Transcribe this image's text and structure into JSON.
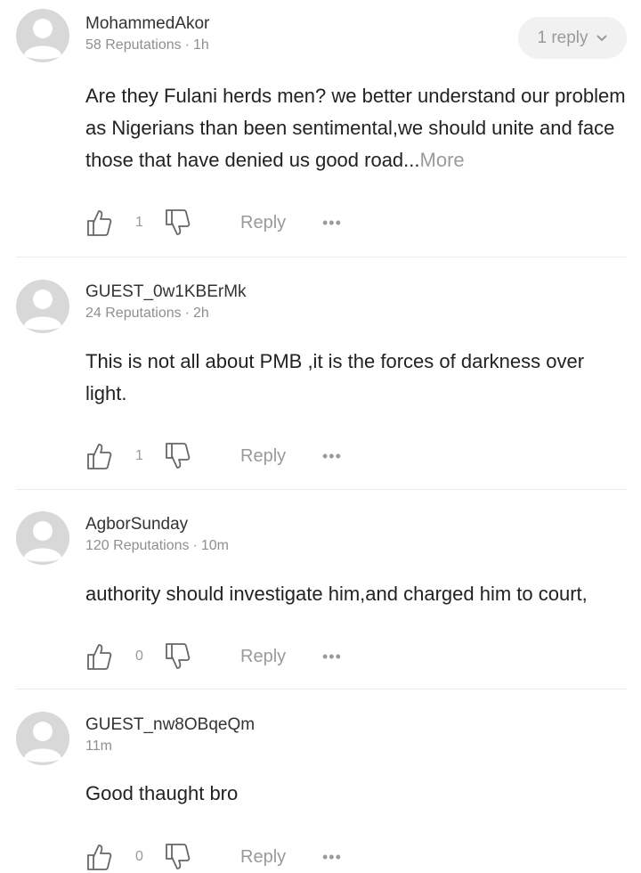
{
  "comments": [
    {
      "username": "MohammedAkor",
      "reputations": "58 Reputations",
      "time": "1h",
      "replies_label": "1 reply",
      "body": "Are they Fulani herds men? we better understand our problem as Nigerians than been sentimental,we should unite and face those that have denied us good road...",
      "more_label": "More",
      "likes": "1",
      "reply_label": "Reply"
    },
    {
      "username": "GUEST_0w1KBErMk",
      "reputations": "24 Reputations",
      "time": "2h",
      "body": "This is not all about PMB ,it is the forces of darkness over light.",
      "likes": "1",
      "reply_label": "Reply"
    },
    {
      "username": "AgborSunday",
      "reputations": "120 Reputations",
      "time": "10m",
      "body": "authority should investigate him,and charged him to court,",
      "likes": "0",
      "reply_label": "Reply"
    },
    {
      "username": "GUEST_nw8OBqeQm",
      "time": "11m",
      "body": "Good thaught bro",
      "likes": "0",
      "reply_label": "Reply"
    }
  ],
  "meta_separator": "·",
  "more_options_glyph": "•••",
  "icons": {
    "avatar": "user-avatar-icon",
    "like": "thumbs-up-icon",
    "dislike": "thumbs-down-icon",
    "chevron": "chevron-down-icon"
  },
  "colors": {
    "text": "#222222",
    "muted": "#9a9a9a",
    "avatar_bg": "#d8d8d8",
    "pill_bg": "#f1f1f1",
    "divider": "#ececec"
  }
}
